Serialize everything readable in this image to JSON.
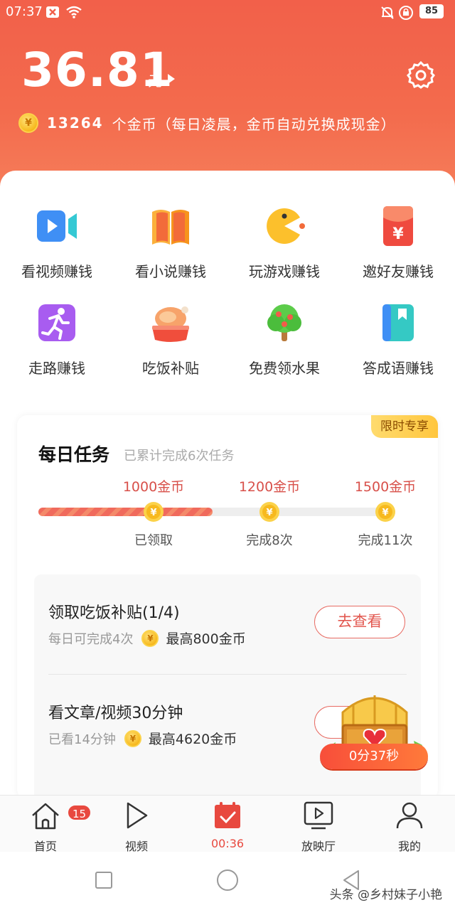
{
  "status": {
    "time": "07:37",
    "battery": "85",
    "icons": [
      "close-box-icon",
      "wifi-icon",
      "bell-muted-icon",
      "lock-clock-icon"
    ]
  },
  "wallet": {
    "amount": "36.81",
    "unit": "元",
    "coin_count": "13264",
    "coin_desc": "个金币（每日凌晨，金币自动兑换成现金）",
    "coin_symbol": "¥"
  },
  "features": [
    {
      "label": "看视频赚钱",
      "icon": "video-camera-icon"
    },
    {
      "label": "看小说赚钱",
      "icon": "open-book-icon"
    },
    {
      "label": "玩游戏赚钱",
      "icon": "pacman-icon"
    },
    {
      "label": "邀好友赚钱",
      "icon": "red-envelope-icon"
    },
    {
      "label": "走路赚钱",
      "icon": "running-person-icon"
    },
    {
      "label": "吃饭补贴",
      "icon": "roast-chicken-icon"
    },
    {
      "label": "免费领水果",
      "icon": "fruit-tree-icon"
    },
    {
      "label": "答成语赚钱",
      "icon": "bookmark-book-icon"
    }
  ],
  "daily_tasks": {
    "badge": "限时专享",
    "title": "每日任务",
    "subtitle": "已累计完成6次任务",
    "progress": 0.49,
    "milestones": [
      {
        "coins": "1000金币",
        "status": "已领取"
      },
      {
        "coins": "1200金币",
        "status": "完成8次"
      },
      {
        "coins": "1500金币",
        "status": "完成11次"
      }
    ],
    "tasks": [
      {
        "title": "领取吃饭补贴(1/4)",
        "meta": "每日可完成4次",
        "reward": "最高800金币",
        "button": "去查看"
      },
      {
        "title": "看文章/视频30分钟",
        "meta": "已看14分钟",
        "reward": "最高4620金币",
        "button": "去"
      }
    ]
  },
  "treasure": {
    "timer": "0分37秒"
  },
  "nav": [
    {
      "label": "首页",
      "icon": "home-icon",
      "badge": "15"
    },
    {
      "label": "视频",
      "icon": "play-icon"
    },
    {
      "label": "00:36",
      "icon": "calendar-check-icon",
      "active": true
    },
    {
      "label": "放映厅",
      "icon": "tv-play-icon"
    },
    {
      "label": "我的",
      "icon": "person-icon"
    }
  ],
  "watermark": "头条 @乡村妹子小艳",
  "colors": {
    "accent": "#f2604a",
    "nav_active": "#e8493f",
    "coin": "#f7b91e"
  }
}
